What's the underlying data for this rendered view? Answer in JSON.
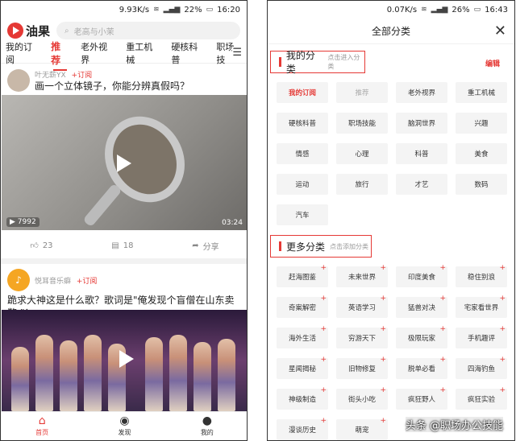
{
  "left": {
    "status": {
      "speed": "9.93K/s",
      "battery": "22%",
      "time": "16:20"
    },
    "app_name": "油果",
    "search_placeholder": "老高与小茉",
    "tabs": [
      "我的订阅",
      "推荐",
      "老外视界",
      "重工机械",
      "硬核科普",
      "职场技"
    ],
    "active_tab": "推荐",
    "post1": {
      "author": "叶无薪YX",
      "follow": "+订阅",
      "title": "画一个立体镜子，你能分辨真假吗？",
      "views": "7992",
      "duration": "03:24",
      "likes": "23",
      "comments": "18",
      "share": "分享"
    },
    "post2": {
      "author": "悦耳音乐癖",
      "follow": "+订阅",
      "title": "跪求大神这是什么歌？歌词是\"俺发现个盲僧在山东卖鳖 \"！"
    },
    "nav": [
      "首页",
      "发现",
      "我的"
    ]
  },
  "right": {
    "status": {
      "speed": "0.07K/s",
      "battery": "26%",
      "time": "16:43"
    },
    "title": "全部分类",
    "my_section": {
      "title": "我的分类",
      "hint": "点击进入分类",
      "edit": "编辑"
    },
    "my_categories": [
      "我的订阅",
      "推荐",
      "老外视界",
      "重工机械",
      "硬核科普",
      "职场技能",
      "脑洞世界",
      "兴趣",
      "情感",
      "心理",
      "科普",
      "美食",
      "运动",
      "旅行",
      "才艺",
      "数码",
      "汽车"
    ],
    "more_section": {
      "title": "更多分类",
      "hint": "点击添加分类"
    },
    "more_categories": [
      "赶海图鉴",
      "未来世界",
      "印度美食",
      "稳住别浪",
      "奇案解密",
      "英语学习",
      "猛兽对决",
      "宅家看世界",
      "海外生活",
      "穷游天下",
      "极限玩家",
      "手机趣评",
      "星闻揭秘",
      "旧物修复",
      "脱单必看",
      "四海钓鱼",
      "神级制造",
      "街头小吃",
      "疯狂野人",
      "疯狂实验",
      "漫谈历史",
      "萌宠"
    ],
    "watermark": "头条 @职场办公技能"
  }
}
